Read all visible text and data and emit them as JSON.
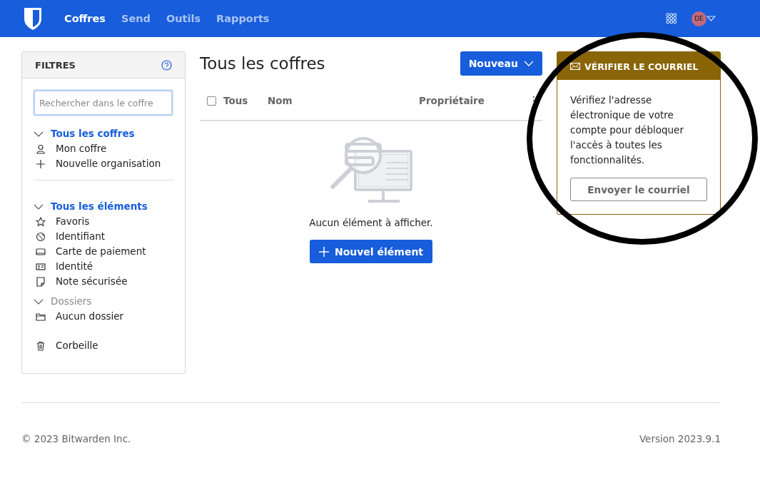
{
  "header": {
    "nav": [
      {
        "label": "Coffres",
        "selected": true
      },
      {
        "label": "Send",
        "selected": false
      },
      {
        "label": "Outils",
        "selected": false
      },
      {
        "label": "Rapports",
        "selected": false
      }
    ],
    "avatar": "DE"
  },
  "filters": {
    "title": "FILTRES",
    "search": {
      "placeholder": "Rechercher dans le coffre"
    },
    "groups": [
      {
        "label": "Tous les coffres",
        "selected": true,
        "items": [
          {
            "label": "Mon coffre",
            "kind": "user",
            "selected": false
          },
          {
            "label": "Nouvelle organisation",
            "kind": "plus",
            "selected": false
          }
        ]
      },
      {
        "label": "Tous les éléments",
        "selected": true,
        "items": [
          {
            "label": "Favoris",
            "kind": "star",
            "selected": false
          },
          {
            "label": "Identifiant",
            "kind": "globe",
            "selected": false
          },
          {
            "label": "Carte de paiement",
            "kind": "card",
            "selected": false
          },
          {
            "label": "Identité",
            "kind": "id",
            "selected": false
          },
          {
            "label": "Note sécurisée",
            "kind": "note",
            "selected": false
          }
        ]
      },
      {
        "label": "Dossiers",
        "selected": false,
        "items": [
          {
            "label": "Aucun dossier",
            "kind": "folder",
            "selected": false
          }
        ]
      }
    ],
    "trash": {
      "label": "Corbeille",
      "selected": false
    }
  },
  "main": {
    "title": "Tous les coffres",
    "new_button": "Nouveau",
    "columns": [
      "Tous",
      "Nom",
      "Propriétaire"
    ],
    "select_all": {
      "checked": false
    },
    "empty_text": "Aucun élément à afficher.",
    "new_item_button": "Nouvel élément"
  },
  "verify_card": {
    "title": "VÉRIFIER LE COURRIEL",
    "body": "Vérifiez l'adresse électronique de votre compte pour débloquer l'accès à toutes les fonctionnalités.",
    "button": "Envoyer le courriel"
  },
  "footer": {
    "copyright": "© 2023 Bitwarden Inc.",
    "version": "Version 2023.9.1"
  }
}
